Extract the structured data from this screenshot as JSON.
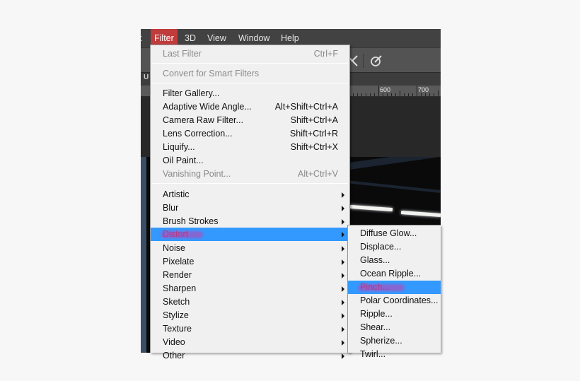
{
  "menubar": {
    "partial_left": "t",
    "items": [
      "Filter",
      "3D",
      "View",
      "Window",
      "Help"
    ],
    "active": "Filter"
  },
  "tab_fragment": "U",
  "ruler": {
    "labels": [
      "600",
      "700"
    ]
  },
  "filter_menu": {
    "groups": [
      [
        {
          "label": "Last Filter",
          "shortcut": "Ctrl+F",
          "disabled": true
        }
      ],
      [
        {
          "label": "Convert for Smart Filters",
          "shortcut": "",
          "disabled": true
        }
      ],
      [
        {
          "label": "Filter Gallery...",
          "shortcut": ""
        },
        {
          "label": "Adaptive Wide Angle...",
          "shortcut": "Alt+Shift+Ctrl+A"
        },
        {
          "label": "Camera Raw Filter...",
          "shortcut": "Shift+Ctrl+A"
        },
        {
          "label": "Lens Correction...",
          "shortcut": "Shift+Ctrl+R"
        },
        {
          "label": "Liquify...",
          "shortcut": "Shift+Ctrl+X"
        },
        {
          "label": "Oil Paint...",
          "shortcut": ""
        },
        {
          "label": "Vanishing Point...",
          "shortcut": "Alt+Ctrl+V",
          "disabled": true
        }
      ],
      [
        {
          "label": "Artistic",
          "submenu": true
        },
        {
          "label": "Blur",
          "submenu": true
        },
        {
          "label": "Brush Strokes",
          "submenu": true
        },
        {
          "label": "Distort",
          "submenu": true,
          "highlighted": true
        },
        {
          "label": "Noise",
          "submenu": true
        },
        {
          "label": "Pixelate",
          "submenu": true
        },
        {
          "label": "Render",
          "submenu": true
        },
        {
          "label": "Sharpen",
          "submenu": true
        },
        {
          "label": "Sketch",
          "submenu": true
        },
        {
          "label": "Stylize",
          "submenu": true
        },
        {
          "label": "Texture",
          "submenu": true
        },
        {
          "label": "Video",
          "submenu": true
        },
        {
          "label": "Other",
          "submenu": true
        }
      ]
    ]
  },
  "distort_submenu": {
    "items": [
      {
        "label": "Diffuse Glow..."
      },
      {
        "label": "Displace..."
      },
      {
        "label": "Glass..."
      },
      {
        "label": "Ocean Ripple..."
      },
      {
        "label": "Pinch...",
        "highlighted": true
      },
      {
        "label": "Polar Coordinates..."
      },
      {
        "label": "Ripple..."
      },
      {
        "label": "Shear..."
      },
      {
        "label": "Spherize..."
      },
      {
        "label": "Twirl..."
      }
    ]
  },
  "colors": {
    "menu_highlight": "#3399ff",
    "menubar_active": "#c03c3c",
    "scribble": "#cd3caa"
  }
}
